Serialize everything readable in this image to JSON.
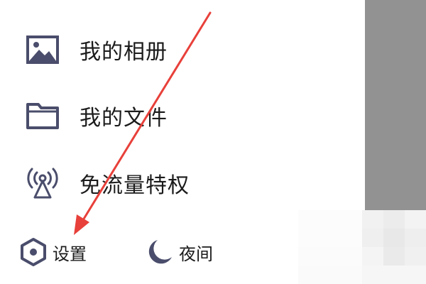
{
  "menu": {
    "items": [
      {
        "label": "我的相册",
        "icon": "image-icon"
      },
      {
        "label": "我的文件",
        "icon": "folder-icon"
      },
      {
        "label": "免流量特权",
        "icon": "broadcast-tower-icon"
      }
    ]
  },
  "footer": {
    "settings_label": "设置",
    "settings_icon": "settings-hexagon-icon",
    "night_label": "夜间",
    "night_icon": "moon-icon"
  },
  "annotation": {
    "arrow_color": "#e8403a",
    "target": "settings"
  },
  "colors": {
    "icon": "#4a4d6b",
    "text": "#1b1b1b",
    "overlay": "#929292"
  }
}
